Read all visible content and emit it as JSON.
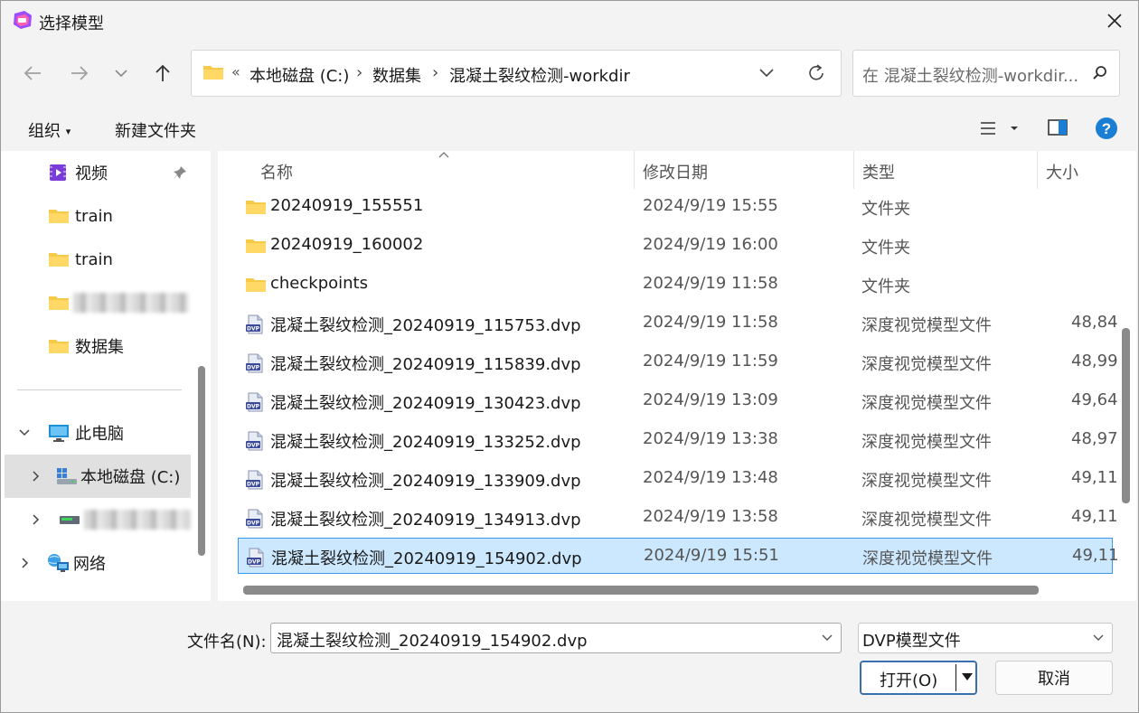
{
  "window": {
    "title": "选择模型"
  },
  "address": {
    "overflow": "«",
    "crumbs": [
      "本地磁盘 (C:)",
      "数据集",
      "混凝土裂纹检测-workdir"
    ]
  },
  "search": {
    "placeholder": "在 混凝土裂纹检测-workdir..."
  },
  "toolbar": {
    "organize": "组织",
    "new_folder": "新建文件夹"
  },
  "sidebar": {
    "items": [
      {
        "label": "视频"
      },
      {
        "label": "train"
      },
      {
        "label": "train"
      },
      {
        "label": "数据集"
      }
    ],
    "this_pc": "此电脑",
    "local_disk": "本地磁盘 (C:)",
    "network": "网络"
  },
  "columns": {
    "name": "名称",
    "date": "修改日期",
    "type": "类型",
    "size": "大小"
  },
  "files": [
    {
      "name": "20240919_155551",
      "date": "2024/9/19 15:55",
      "type": "文件夹",
      "size": "",
      "kind": "folder"
    },
    {
      "name": "20240919_160002",
      "date": "2024/9/19 16:00",
      "type": "文件夹",
      "size": "",
      "kind": "folder"
    },
    {
      "name": "checkpoints",
      "date": "2024/9/19 11:58",
      "type": "文件夹",
      "size": "",
      "kind": "folder"
    },
    {
      "name": "混凝土裂纹检测_20240919_115753.dvp",
      "date": "2024/9/19 11:58",
      "type": "深度视觉模型文件",
      "size": "48,84",
      "kind": "dvp"
    },
    {
      "name": "混凝土裂纹检测_20240919_115839.dvp",
      "date": "2024/9/19 11:59",
      "type": "深度视觉模型文件",
      "size": "48,99",
      "kind": "dvp"
    },
    {
      "name": "混凝土裂纹检测_20240919_130423.dvp",
      "date": "2024/9/19 13:09",
      "type": "深度视觉模型文件",
      "size": "49,64",
      "kind": "dvp"
    },
    {
      "name": "混凝土裂纹检测_20240919_133252.dvp",
      "date": "2024/9/19 13:38",
      "type": "深度视觉模型文件",
      "size": "48,97",
      "kind": "dvp"
    },
    {
      "name": "混凝土裂纹检测_20240919_133909.dvp",
      "date": "2024/9/19 13:48",
      "type": "深度视觉模型文件",
      "size": "49,11",
      "kind": "dvp"
    },
    {
      "name": "混凝土裂纹检测_20240919_134913.dvp",
      "date": "2024/9/19 13:58",
      "type": "深度视觉模型文件",
      "size": "49,11",
      "kind": "dvp"
    },
    {
      "name": "混凝土裂纹检测_20240919_154902.dvp",
      "date": "2024/9/19 15:51",
      "type": "深度视觉模型文件",
      "size": "49,11",
      "kind": "dvp",
      "selected": true
    }
  ],
  "footer": {
    "filename_label": "文件名(N):",
    "filename_value": "混凝土裂纹检测_20240919_154902.dvp",
    "filetype_value": "DVP模型文件",
    "open_label": "打开(O)",
    "cancel_label": "取消"
  },
  "colors": {
    "accent": "#3a98f5",
    "selection": "#cce8ff",
    "folder": "#f7c948",
    "help": "#1a7fd4"
  }
}
